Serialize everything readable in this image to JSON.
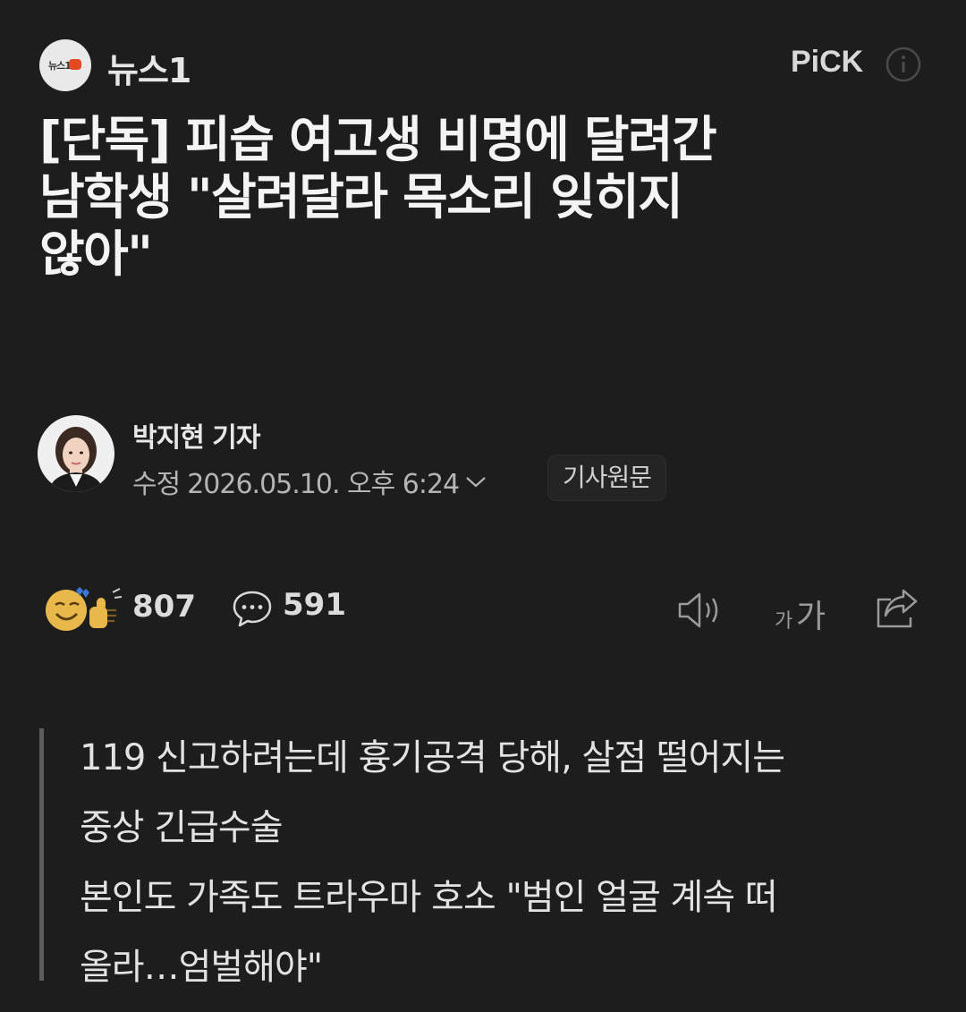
{
  "header": {
    "logo_text": "뉴스1",
    "press_name": "뉴스1",
    "pick_label": "PiCK",
    "info_icon": "info-icon"
  },
  "article": {
    "title_lines": [
      "[단독] 피습 여고생 비명에 달려간",
      "남학생 \"살려달라 목소리 잊히지",
      "않아\""
    ],
    "reporter": "박지현 기자",
    "edited_label": "수정",
    "edited_time": "2026.05.10. 오후 6:24",
    "original_button": "기사원문"
  },
  "toolbar": {
    "reaction_count": "807",
    "comment_count": "591",
    "font_small": "가",
    "font_large": "가",
    "icons": [
      "reaction-icon",
      "comment-icon",
      "speaker-icon",
      "font-size-icon",
      "share-icon"
    ]
  },
  "summary": {
    "lines": [
      "119 신고하려는데 흉기공격 당해, 살점 떨어지는",
      "중상 긴급수술",
      "본인도 가족도 트라우마 호소 \"범인 얼굴 계속 떠",
      "올라…엄벌해야\""
    ]
  },
  "colors": {
    "background": "#1d1d1e",
    "text": "#f2f2f2",
    "muted": "#b4b4b4",
    "summary_bar": "#5c5c5e"
  }
}
